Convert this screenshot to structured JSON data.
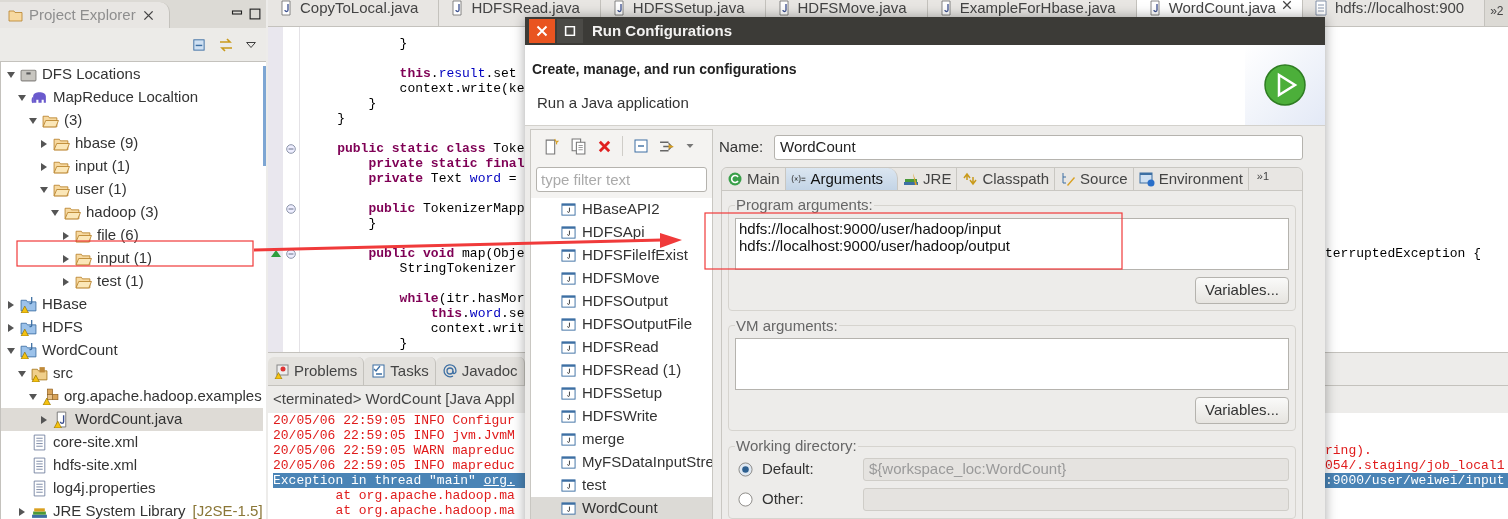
{
  "explorer": {
    "title": "Project Explorer",
    "tree": [
      {
        "label": "DFS Locations",
        "kind": "dfs",
        "expanded": true,
        "selected": false,
        "children": [
          {
            "label": "MapReduce Localtion",
            "kind": "elephant",
            "expanded": true,
            "selected": false,
            "children": [
              {
                "label": "(3)",
                "kind": "folder",
                "expanded": true,
                "selected": false,
                "children": [
                  {
                    "label": "hbase (9)",
                    "kind": "folder",
                    "expanded": false,
                    "selected": false
                  },
                  {
                    "label": "input (1)",
                    "kind": "folder",
                    "expanded": false,
                    "selected": false
                  },
                  {
                    "label": "user (1)",
                    "kind": "folder",
                    "expanded": true,
                    "selected": false,
                    "children": [
                      {
                        "label": "hadoop (3)",
                        "kind": "folder",
                        "expanded": true,
                        "selected": false,
                        "children": [
                          {
                            "label": "file (6)",
                            "kind": "folder",
                            "expanded": false,
                            "selected": false
                          },
                          {
                            "label": "input (1)",
                            "kind": "folder",
                            "expanded": false,
                            "selected": false
                          },
                          {
                            "label": "test (1)",
                            "kind": "folder",
                            "expanded": false,
                            "selected": false
                          }
                        ]
                      }
                    ]
                  }
                ]
              }
            ]
          }
        ]
      },
      {
        "label": "HBase",
        "kind": "project",
        "expanded": false,
        "selected": false
      },
      {
        "label": "HDFS",
        "kind": "project",
        "expanded": false,
        "selected": false
      },
      {
        "label": "WordCount",
        "kind": "project",
        "expanded": true,
        "selected": false,
        "children": [
          {
            "label": "src",
            "kind": "source",
            "expanded": true,
            "selected": false,
            "children": [
              {
                "label": "org.apache.hadoop.examples",
                "kind": "package",
                "expanded": true,
                "selected": false,
                "children": [
                  {
                    "label": "WordCount.java",
                    "kind": "java",
                    "expanded": false,
                    "selected": true
                  }
                ]
              }
            ]
          },
          {
            "label": "core-site.xml",
            "kind": "file",
            "selected": false
          },
          {
            "label": "hdfs-site.xml",
            "kind": "file",
            "selected": false
          },
          {
            "label": "log4j.properties",
            "kind": "file",
            "selected": false
          },
          {
            "label": "JRE System Library",
            "decoration": "[J2SE-1.5]",
            "kind": "library",
            "expanded": false,
            "selected": false
          }
        ]
      }
    ]
  },
  "editor": {
    "tabs": [
      {
        "label": "CopyToLocal.java",
        "kind": "java",
        "selected": false
      },
      {
        "label": "HDFSRead.java",
        "kind": "java",
        "selected": false
      },
      {
        "label": "HDFSSetup.java",
        "kind": "java",
        "selected": false
      },
      {
        "label": "HDFSMove.java",
        "kind": "java",
        "selected": false
      },
      {
        "label": "ExampleForHbase.java",
        "kind": "java",
        "selected": false
      },
      {
        "label": "WordCount.java",
        "kind": "java",
        "selected": true
      },
      {
        "label": "hdfs://localhost:900",
        "kind": "file",
        "selected": false
      }
    ],
    "tabs_overflow": "»2",
    "code_lines": [
      {
        "kind": "code",
        "segments": [
          {
            "text": "            }",
            "kind": "plain"
          }
        ]
      },
      {
        "kind": "blank"
      },
      {
        "kind": "code",
        "segments": [
          {
            "text": "            this",
            "kind": "keyword"
          },
          {
            "text": ".",
            "kind": "plain"
          },
          {
            "text": "result",
            "kind": "field"
          },
          {
            "text": ".set",
            "kind": "plain"
          }
        ]
      },
      {
        "kind": "code",
        "segments": [
          {
            "text": "            context.write(ke",
            "kind": "plain"
          }
        ]
      },
      {
        "kind": "code",
        "segments": [
          {
            "text": "        }",
            "kind": "plain"
          }
        ]
      },
      {
        "kind": "code",
        "segments": [
          {
            "text": "    }",
            "kind": "plain"
          }
        ]
      },
      {
        "kind": "blank"
      },
      {
        "kind": "code",
        "foldable": true,
        "segments": [
          {
            "text": "    public static class",
            "kind": "keyword"
          },
          {
            "text": " Toke",
            "kind": "plain"
          }
        ]
      },
      {
        "kind": "code",
        "segments": [
          {
            "text": "        private static final",
            "kind": "keyword"
          }
        ]
      },
      {
        "kind": "code",
        "segments": [
          {
            "text": "        private",
            "kind": "keyword"
          },
          {
            "text": " Text ",
            "kind": "plain"
          },
          {
            "text": "word",
            "kind": "field"
          },
          {
            "text": " =",
            "kind": "plain"
          }
        ]
      },
      {
        "kind": "blank"
      },
      {
        "kind": "code",
        "foldable": true,
        "segments": [
          {
            "text": "        public",
            "kind": "keyword"
          },
          {
            "text": " TokenizerMapp",
            "kind": "plain"
          }
        ]
      },
      {
        "kind": "code",
        "segments": [
          {
            "text": "        }",
            "kind": "plain"
          }
        ]
      },
      {
        "kind": "blank"
      },
      {
        "kind": "code",
        "foldable": true,
        "override": true,
        "segments": [
          {
            "text": "        public void",
            "kind": "keyword"
          },
          {
            "text": " map(Obje",
            "kind": "plain"
          }
        ],
        "right": "terruptedException {"
      },
      {
        "kind": "code",
        "segments": [
          {
            "text": "            StringTokenizer",
            "kind": "plain"
          }
        ]
      },
      {
        "kind": "blank"
      },
      {
        "kind": "code",
        "segments": [
          {
            "text": "            while",
            "kind": "keyword"
          },
          {
            "text": "(itr.hasMor",
            "kind": "plain"
          }
        ]
      },
      {
        "kind": "code",
        "segments": [
          {
            "text": "                this",
            "kind": "keyword"
          },
          {
            "text": ".",
            "kind": "plain"
          },
          {
            "text": "word",
            "kind": "field"
          },
          {
            "text": ".se",
            "kind": "plain"
          }
        ]
      },
      {
        "kind": "code",
        "segments": [
          {
            "text": "                context.writ",
            "kind": "plain"
          }
        ]
      },
      {
        "kind": "code",
        "segments": [
          {
            "text": "            }",
            "kind": "plain"
          }
        ]
      }
    ]
  },
  "console": {
    "tabs": [
      {
        "label": "Problems",
        "kind": "problems",
        "selected": false
      },
      {
        "label": "Tasks",
        "kind": "tasks",
        "selected": false
      },
      {
        "label": "Javadoc",
        "kind": "javadoc",
        "selected": false
      }
    ],
    "header": "<terminated> WordCount [Java Appl",
    "lines": [
      {
        "text": "20/05/06 22:59:05 INFO Configur",
        "selected": false
      },
      {
        "text": "20/05/06 22:59:05 INFO jvm.JvmM",
        "selected": false
      },
      {
        "text": "20/05/06 22:59:05 WARN mapreduc",
        "selected": false,
        "right": "ring)."
      },
      {
        "text": "20/05/06 22:59:05 INFO mapreduc",
        "selected": false,
        "right": "054/.staging/job_local1"
      },
      {
        "text": "Exception in thread \"main\" ",
        "link": "org.",
        "selected": true,
        "right": ":9000/user/weiwei/input"
      },
      {
        "text": "        at org.apache.hadoop.ma",
        "selected": false
      },
      {
        "text": "        at org.apache.hadoop.ma",
        "selected": false
      }
    ]
  },
  "dialog": {
    "title": "Run Configurations",
    "heading": "Create, manage, and run configurations",
    "message": "Run a Java application",
    "filter": {
      "placeholder": "type filter text"
    },
    "configurations": [
      {
        "label": "HBaseAPI2",
        "selected": false
      },
      {
        "label": "HDFSApi",
        "selected": false
      },
      {
        "label": "HDFSFileIfExist",
        "selected": false
      },
      {
        "label": "HDFSMove",
        "selected": false
      },
      {
        "label": "HDFSOutput",
        "selected": false
      },
      {
        "label": "HDFSOutputFile",
        "selected": false
      },
      {
        "label": "HDFSRead",
        "selected": false
      },
      {
        "label": "HDFSRead (1)",
        "selected": false
      },
      {
        "label": "HDFSSetup",
        "selected": false
      },
      {
        "label": "HDFSWrite",
        "selected": false
      },
      {
        "label": "merge",
        "selected": false
      },
      {
        "label": "MyFSDataInputStre",
        "selected": false
      },
      {
        "label": "test",
        "selected": false
      },
      {
        "label": "WordCount",
        "selected": true
      }
    ],
    "name": {
      "label": "Name:",
      "value": "WordCount"
    },
    "tabs": [
      {
        "label": "Main",
        "kind": "main",
        "selected": false
      },
      {
        "label": "Arguments",
        "kind": "arguments",
        "selected": true
      },
      {
        "label": "JRE",
        "kind": "jre",
        "selected": false
      },
      {
        "label": "Classpath",
        "kind": "classpath",
        "selected": false
      },
      {
        "label": "Source",
        "kind": "source",
        "selected": false
      },
      {
        "label": "Environment",
        "kind": "environment",
        "selected": false
      }
    ],
    "tabs_overflow": "»1",
    "program_arguments": {
      "label": "Program arguments:",
      "value": "hdfs://localhost:9000/user/hadoop/input\nhdfs://localhost:9000/user/hadoop/output",
      "button": "Variables..."
    },
    "vm_arguments": {
      "label": "VM arguments:",
      "button": "Variables..."
    },
    "working_directory": {
      "label": "Working directory:",
      "options": [
        {
          "label": "Default:",
          "selected": true,
          "value": "${workspace_loc:WordCount}",
          "disabled": true
        },
        {
          "label": "Other:",
          "selected": false,
          "disabled": true
        }
      ]
    }
  }
}
